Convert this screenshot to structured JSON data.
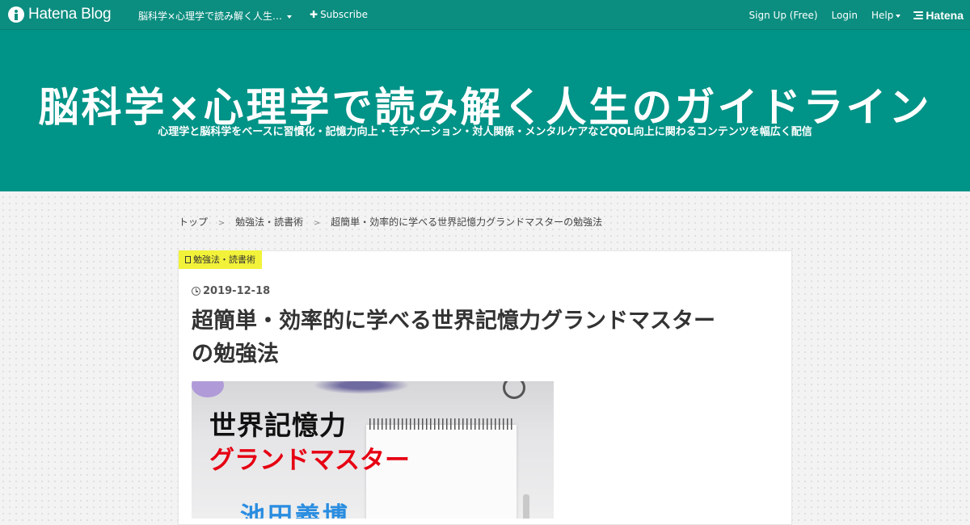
{
  "globalbar": {
    "logo_text": "Hatena Blog",
    "blog_name": "脳科学×心理学で読み解く人生…",
    "subscribe_label": "Subscribe",
    "signup_label": "Sign Up (Free)",
    "login_label": "Login",
    "help_label": "Help",
    "hatena_label": "Hatena"
  },
  "header": {
    "title": "脳科学×心理学で読み解く人生のガイドライン",
    "description": "心理学と脳科学をベースに習慣化・記憶力向上・モチベーション・対人関係・メンタルケアなどQOL向上に関わるコンテンツを幅広く配信"
  },
  "breadcrumb": {
    "items": [
      "トップ",
      "勉強法・読書術",
      "超簡単・効率的に学べる世界記憶力グランドマスターの勉強法"
    ],
    "separator": ">"
  },
  "entry": {
    "category": "勉強法・読書術",
    "date": "2019-12-18",
    "title_line1": "超簡単・効率的に学べる世界記憶力グランドマスター",
    "title_line2": "の勉強法",
    "eyecatch": {
      "line1": "世界記憶力",
      "line2": "グランドマスター",
      "line3": "池田義博"
    }
  },
  "colors": {
    "globalbar": "#0b8d7f",
    "header": "#009387",
    "category_tag": "#f2f23a",
    "eyecatch_red": "#e60012",
    "eyecatch_blue": "#2a8de0"
  }
}
